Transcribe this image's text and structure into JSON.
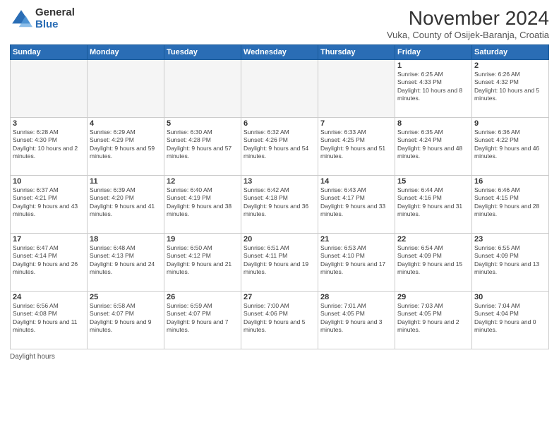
{
  "header": {
    "logo_general": "General",
    "logo_blue": "Blue",
    "month_title": "November 2024",
    "subtitle": "Vuka, County of Osijek-Baranja, Croatia"
  },
  "days_of_week": [
    "Sunday",
    "Monday",
    "Tuesday",
    "Wednesday",
    "Thursday",
    "Friday",
    "Saturday"
  ],
  "weeks": [
    [
      {
        "day": "",
        "info": ""
      },
      {
        "day": "",
        "info": ""
      },
      {
        "day": "",
        "info": ""
      },
      {
        "day": "",
        "info": ""
      },
      {
        "day": "",
        "info": ""
      },
      {
        "day": "1",
        "info": "Sunrise: 6:25 AM\nSunset: 4:33 PM\nDaylight: 10 hours and 8 minutes."
      },
      {
        "day": "2",
        "info": "Sunrise: 6:26 AM\nSunset: 4:32 PM\nDaylight: 10 hours and 5 minutes."
      }
    ],
    [
      {
        "day": "3",
        "info": "Sunrise: 6:28 AM\nSunset: 4:30 PM\nDaylight: 10 hours and 2 minutes."
      },
      {
        "day": "4",
        "info": "Sunrise: 6:29 AM\nSunset: 4:29 PM\nDaylight: 9 hours and 59 minutes."
      },
      {
        "day": "5",
        "info": "Sunrise: 6:30 AM\nSunset: 4:28 PM\nDaylight: 9 hours and 57 minutes."
      },
      {
        "day": "6",
        "info": "Sunrise: 6:32 AM\nSunset: 4:26 PM\nDaylight: 9 hours and 54 minutes."
      },
      {
        "day": "7",
        "info": "Sunrise: 6:33 AM\nSunset: 4:25 PM\nDaylight: 9 hours and 51 minutes."
      },
      {
        "day": "8",
        "info": "Sunrise: 6:35 AM\nSunset: 4:24 PM\nDaylight: 9 hours and 48 minutes."
      },
      {
        "day": "9",
        "info": "Sunrise: 6:36 AM\nSunset: 4:22 PM\nDaylight: 9 hours and 46 minutes."
      }
    ],
    [
      {
        "day": "10",
        "info": "Sunrise: 6:37 AM\nSunset: 4:21 PM\nDaylight: 9 hours and 43 minutes."
      },
      {
        "day": "11",
        "info": "Sunrise: 6:39 AM\nSunset: 4:20 PM\nDaylight: 9 hours and 41 minutes."
      },
      {
        "day": "12",
        "info": "Sunrise: 6:40 AM\nSunset: 4:19 PM\nDaylight: 9 hours and 38 minutes."
      },
      {
        "day": "13",
        "info": "Sunrise: 6:42 AM\nSunset: 4:18 PM\nDaylight: 9 hours and 36 minutes."
      },
      {
        "day": "14",
        "info": "Sunrise: 6:43 AM\nSunset: 4:17 PM\nDaylight: 9 hours and 33 minutes."
      },
      {
        "day": "15",
        "info": "Sunrise: 6:44 AM\nSunset: 4:16 PM\nDaylight: 9 hours and 31 minutes."
      },
      {
        "day": "16",
        "info": "Sunrise: 6:46 AM\nSunset: 4:15 PM\nDaylight: 9 hours and 28 minutes."
      }
    ],
    [
      {
        "day": "17",
        "info": "Sunrise: 6:47 AM\nSunset: 4:14 PM\nDaylight: 9 hours and 26 minutes."
      },
      {
        "day": "18",
        "info": "Sunrise: 6:48 AM\nSunset: 4:13 PM\nDaylight: 9 hours and 24 minutes."
      },
      {
        "day": "19",
        "info": "Sunrise: 6:50 AM\nSunset: 4:12 PM\nDaylight: 9 hours and 21 minutes."
      },
      {
        "day": "20",
        "info": "Sunrise: 6:51 AM\nSunset: 4:11 PM\nDaylight: 9 hours and 19 minutes."
      },
      {
        "day": "21",
        "info": "Sunrise: 6:53 AM\nSunset: 4:10 PM\nDaylight: 9 hours and 17 minutes."
      },
      {
        "day": "22",
        "info": "Sunrise: 6:54 AM\nSunset: 4:09 PM\nDaylight: 9 hours and 15 minutes."
      },
      {
        "day": "23",
        "info": "Sunrise: 6:55 AM\nSunset: 4:09 PM\nDaylight: 9 hours and 13 minutes."
      }
    ],
    [
      {
        "day": "24",
        "info": "Sunrise: 6:56 AM\nSunset: 4:08 PM\nDaylight: 9 hours and 11 minutes."
      },
      {
        "day": "25",
        "info": "Sunrise: 6:58 AM\nSunset: 4:07 PM\nDaylight: 9 hours and 9 minutes."
      },
      {
        "day": "26",
        "info": "Sunrise: 6:59 AM\nSunset: 4:07 PM\nDaylight: 9 hours and 7 minutes."
      },
      {
        "day": "27",
        "info": "Sunrise: 7:00 AM\nSunset: 4:06 PM\nDaylight: 9 hours and 5 minutes."
      },
      {
        "day": "28",
        "info": "Sunrise: 7:01 AM\nSunset: 4:05 PM\nDaylight: 9 hours and 3 minutes."
      },
      {
        "day": "29",
        "info": "Sunrise: 7:03 AM\nSunset: 4:05 PM\nDaylight: 9 hours and 2 minutes."
      },
      {
        "day": "30",
        "info": "Sunrise: 7:04 AM\nSunset: 4:04 PM\nDaylight: 9 hours and 0 minutes."
      }
    ]
  ],
  "footer": {
    "daylight_label": "Daylight hours"
  }
}
